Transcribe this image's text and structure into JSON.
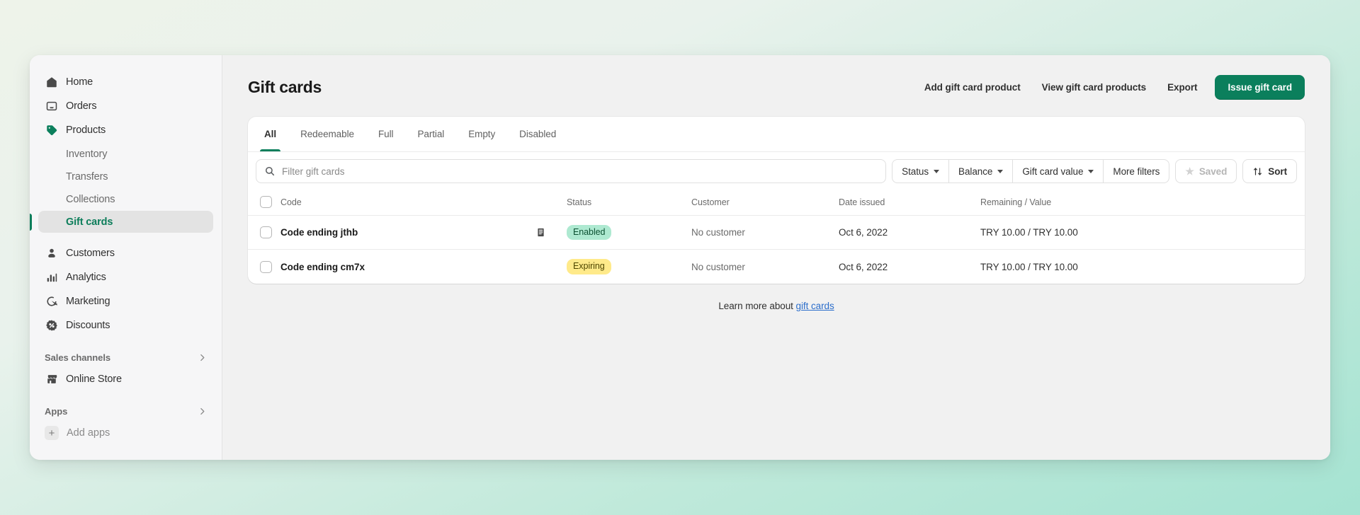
{
  "sidebar": {
    "items": [
      {
        "label": "Home",
        "icon": "home-icon"
      },
      {
        "label": "Orders",
        "icon": "orders-icon"
      },
      {
        "label": "Products",
        "icon": "products-tag-icon"
      }
    ],
    "sub_items": [
      {
        "label": "Inventory",
        "active": false
      },
      {
        "label": "Transfers",
        "active": false
      },
      {
        "label": "Collections",
        "active": false
      },
      {
        "label": "Gift cards",
        "active": true
      }
    ],
    "items2": [
      {
        "label": "Customers",
        "icon": "customers-icon"
      },
      {
        "label": "Analytics",
        "icon": "analytics-bars-icon"
      },
      {
        "label": "Marketing",
        "icon": "marketing-target-icon"
      },
      {
        "label": "Discounts",
        "icon": "discounts-percent-icon"
      }
    ],
    "sales_channels_label": "Sales channels",
    "online_store_label": "Online Store",
    "apps_label": "Apps",
    "add_apps_label": "Add apps",
    "active_color": "#0c7d5a"
  },
  "header": {
    "title": "Gift cards",
    "actions": [
      {
        "label": "Add gift card product"
      },
      {
        "label": "View gift card products"
      },
      {
        "label": "Export"
      }
    ],
    "primary_action": "Issue gift card",
    "primary_color": "#0b7f5c"
  },
  "tabs": [
    {
      "label": "All",
      "active": true
    },
    {
      "label": "Redeemable",
      "active": false
    },
    {
      "label": "Full",
      "active": false
    },
    {
      "label": "Partial",
      "active": false
    },
    {
      "label": "Empty",
      "active": false
    },
    {
      "label": "Disabled",
      "active": false
    }
  ],
  "filters": {
    "search_placeholder": "Filter gift cards",
    "search_value": "",
    "dropdowns": [
      {
        "label": "Status"
      },
      {
        "label": "Balance"
      },
      {
        "label": "Gift card value"
      },
      {
        "label": "More filters"
      }
    ],
    "saved_label": "Saved",
    "sort_label": "Sort"
  },
  "table": {
    "columns": [
      "Code",
      "Status",
      "Customer",
      "Date issued",
      "Remaining / Value"
    ],
    "rows": [
      {
        "code": "Code ending jthb",
        "has_note": true,
        "status": "Enabled",
        "status_type": "enabled",
        "customer": "No customer",
        "date_issued": "Oct 6, 2022",
        "remaining_value": "TRY 10.00 / TRY 10.00"
      },
      {
        "code": "Code ending cm7x",
        "has_note": false,
        "status": "Expiring",
        "status_type": "expiring",
        "customer": "No customer",
        "date_issued": "Oct 6, 2022",
        "remaining_value": "TRY 10.00 / TRY 10.00"
      }
    ]
  },
  "footer": {
    "text": "Learn more about ",
    "link": "gift cards"
  }
}
